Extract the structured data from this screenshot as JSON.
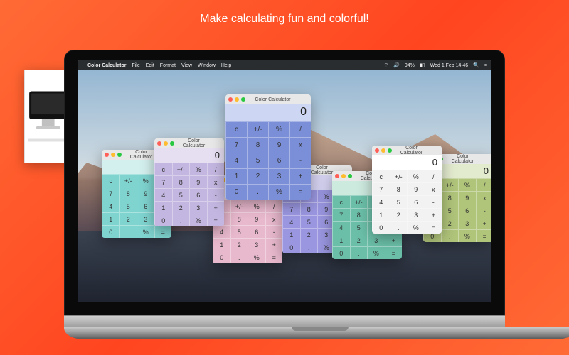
{
  "tagline": "Make calculating fun and colorful!",
  "menubar": {
    "app_name": "Color Calculator",
    "menus": [
      "File",
      "Edit",
      "Format",
      "View",
      "Window",
      "Help"
    ],
    "battery_pct": "94%",
    "clock": "Wed 1 Feb  14:46"
  },
  "calc_title": "Color Calculator",
  "display_value": "0",
  "buttons": {
    "clear": "c",
    "sign": "+/-",
    "percent": "%",
    "divide": "/",
    "multiply": "x",
    "minus": "-",
    "plus": "+",
    "equals": "=",
    "decimal": ".",
    "d0": "0",
    "d1": "1",
    "d2": "2",
    "d3": "3",
    "d4": "4",
    "d5": "5",
    "d6": "6",
    "d7": "7",
    "d8": "8",
    "d9": "9"
  },
  "themes": {
    "blue": "#7b8fd8",
    "cyan": "#7fd4d0",
    "lavender": "#c3b6e0",
    "pink": "#e8b8cc",
    "periwinkle": "#9a96e0",
    "teal": "#6bbfa8",
    "white": "#f2f2f2",
    "olive": "#b0c47a"
  }
}
